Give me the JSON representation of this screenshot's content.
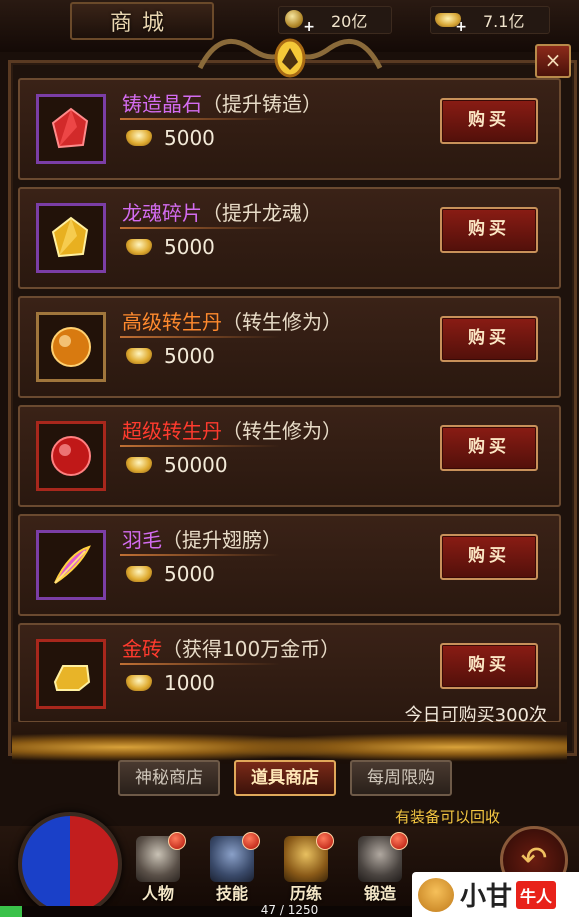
{
  "header": {
    "title": "商城",
    "currencies": [
      {
        "icon": "coin-plus-icon",
        "value": "20亿"
      },
      {
        "icon": "gold-ingot-plus-icon",
        "value": "7.1亿"
      }
    ],
    "close_label": "×"
  },
  "items": [
    {
      "name": "铸造晶石",
      "desc": "（提升铸造）",
      "price": "5000",
      "name_color": "#d36cf0",
      "icon": "red-crystal-icon",
      "buy": "购买"
    },
    {
      "name": "龙魂碎片",
      "desc": "（提升龙魂）",
      "price": "5000",
      "name_color": "#d36cf0",
      "icon": "gold-crystal-icon",
      "buy": "购买"
    },
    {
      "name": "高级转生丹",
      "desc": "（转生修为）",
      "price": "5000",
      "name_color": "#ff8a2e",
      "icon": "orange-pill-icon",
      "buy": "购买"
    },
    {
      "name": "超级转生丹",
      "desc": "（转生修为）",
      "price": "50000",
      "name_color": "#ff3b2e",
      "icon": "red-pill-icon",
      "buy": "购买"
    },
    {
      "name": "羽毛",
      "desc": "（提升翅膀）",
      "price": "5000",
      "name_color": "#d36cf0",
      "icon": "feather-icon",
      "buy": "购买"
    },
    {
      "name": "金砖",
      "desc": "（获得100万金币）",
      "price": "1000",
      "name_color": "#ff3b2e",
      "icon": "gold-brick-icon",
      "buy": "购买",
      "limit": "今日可购买300次"
    }
  ],
  "tabs": [
    {
      "label": "神秘商店",
      "active": false
    },
    {
      "label": "道具商店",
      "active": true
    },
    {
      "label": "每周限购",
      "active": false
    }
  ],
  "tip": "有装备可以回收",
  "nav": [
    {
      "label": "人物",
      "icon": "helmet-icon"
    },
    {
      "label": "技能",
      "icon": "skill-book-icon"
    },
    {
      "label": "历练",
      "icon": "armor-icon"
    },
    {
      "label": "锻造",
      "icon": "anvil-icon"
    }
  ],
  "progress": {
    "text": "47 / 1250",
    "fraction": 0.0376
  },
  "watermark": {
    "text1": "小甘",
    "text2": "牛人"
  }
}
